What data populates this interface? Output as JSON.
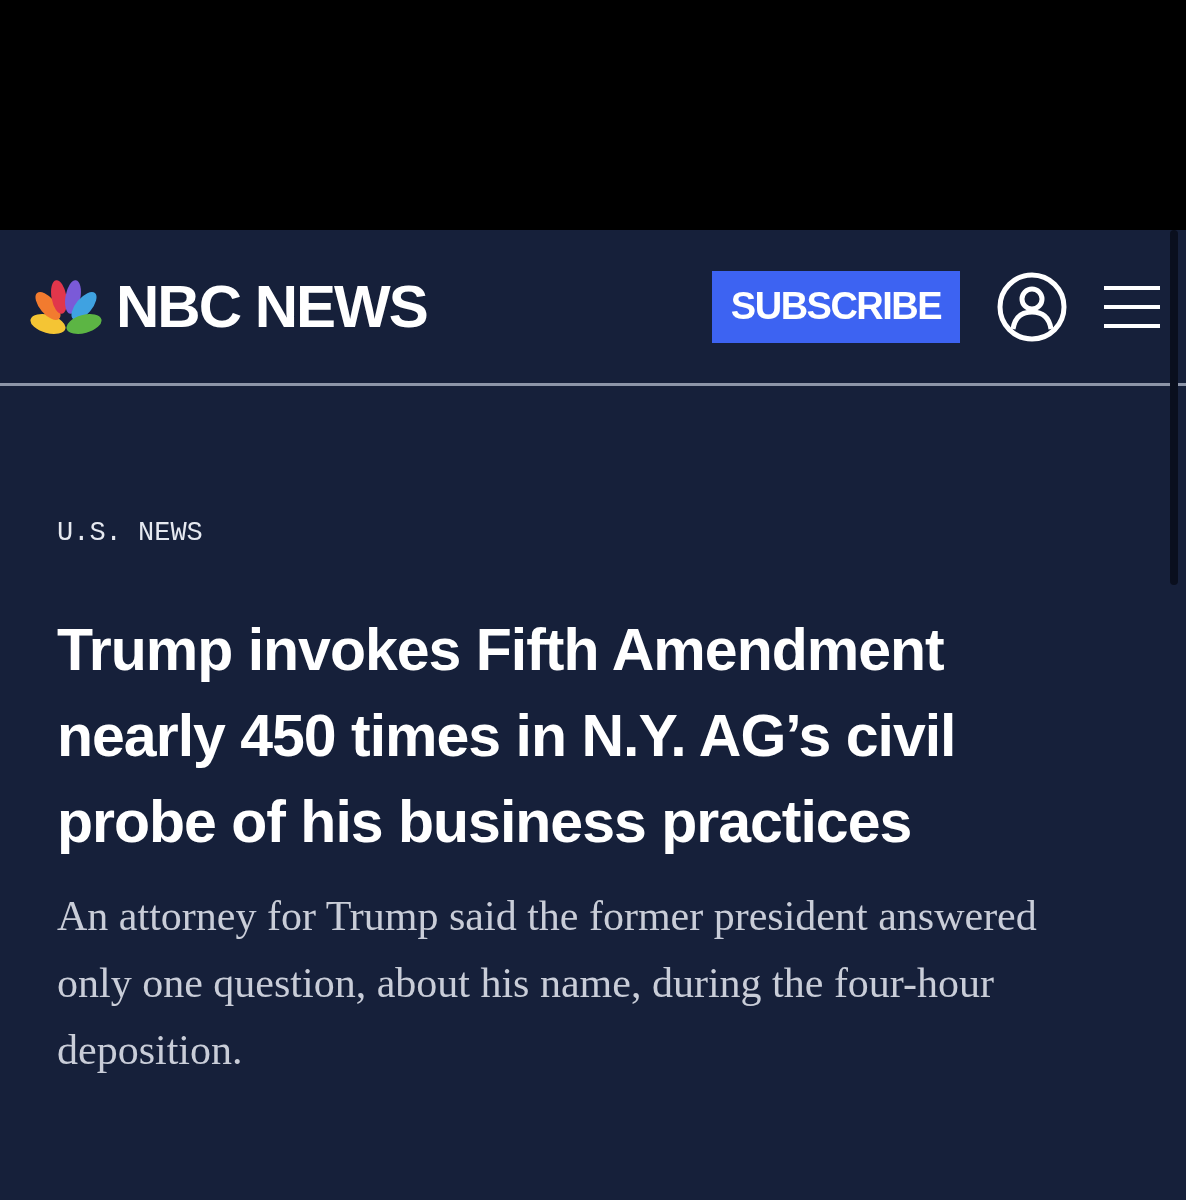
{
  "header": {
    "logo_text": "NBC NEWS",
    "subscribe_button": "SUBSCRIBE"
  },
  "article": {
    "section": "U.S. NEWS",
    "headline": "Trump invokes Fifth Amendment nearly 450 times in N.Y. AG’s civil probe of his business practices",
    "summary": "An attorney for Trump said the former president answered only one question, about his name, during the four-hour deposition."
  }
}
